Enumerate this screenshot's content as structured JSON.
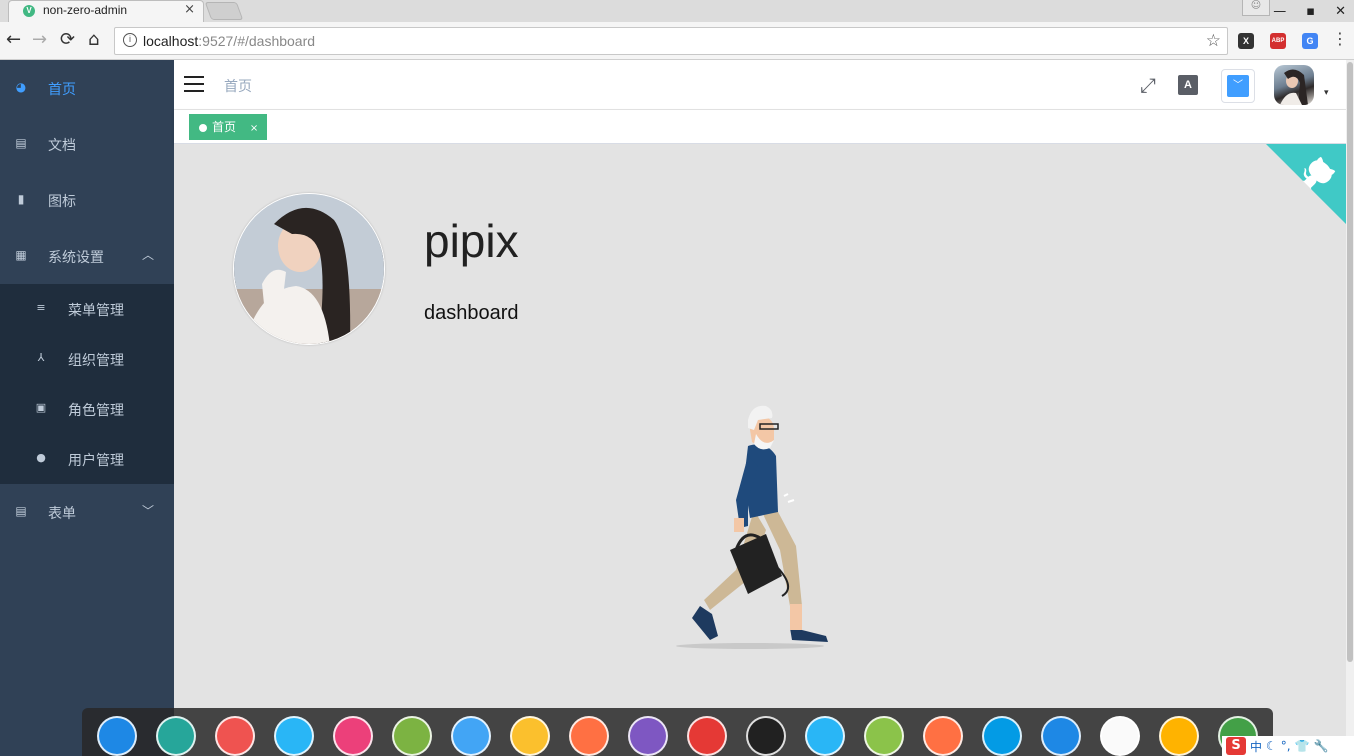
{
  "browser": {
    "tab_title": "non-zero-admin",
    "tab_close": "×",
    "favicon": "V",
    "url_host": "localhost",
    "url_rest": ":9527/#/dashboard",
    "back_icon": "←",
    "forward_icon": "→",
    "reload_icon": "⟳",
    "home_icon": "⌂",
    "info_icon": "i",
    "star_icon": "☆",
    "menu_icon": "⋮",
    "min_icon": "—",
    "max_icon": "▪",
    "close_icon": "✕",
    "extensions": [
      {
        "name": "x-extension-icon",
        "text": "X",
        "color": "#333333"
      },
      {
        "name": "adblock-plus-icon",
        "text": "ABP",
        "color": "#d32f2f"
      },
      {
        "name": "google-translate-icon",
        "text": "G",
        "color": "#4285f4"
      }
    ]
  },
  "sidebar": {
    "bg_color": "#304156",
    "active_color": "#409eff",
    "items": [
      {
        "label": "首页",
        "icon": "dashboard-icon",
        "glyph": "◕"
      },
      {
        "label": "文档",
        "icon": "document-icon",
        "glyph": "▤"
      },
      {
        "label": "图标",
        "icon": "icon-icon",
        "glyph": "▮"
      },
      {
        "label": "系统设置",
        "icon": "grid-icon",
        "glyph": "▦",
        "arrow": "︿"
      },
      {
        "label": "表单",
        "icon": "form-icon",
        "glyph": "▤",
        "arrow": "﹀"
      }
    ],
    "submenu": [
      {
        "label": "菜单管理",
        "icon": "menu-list-icon",
        "glyph": "≡"
      },
      {
        "label": "组织管理",
        "icon": "tree-icon",
        "glyph": "⅄"
      },
      {
        "label": "角色管理",
        "icon": "role-icon",
        "glyph": "▣"
      },
      {
        "label": "用户管理",
        "icon": "user-icon",
        "glyph": "●"
      }
    ]
  },
  "navbar": {
    "breadcrumb": "首页",
    "fullscreen_icon": "⤢",
    "lang_icon": "A",
    "theme_caret": "﹀",
    "avatar_caret": "▾"
  },
  "tags": {
    "active": "首页",
    "close": "×",
    "color": "#42b983"
  },
  "dashboard": {
    "username": "pipix",
    "role": "dashboard"
  },
  "dock": {
    "icons": [
      {
        "name": "deepin-launcher-icon",
        "color": "#1e88e5"
      },
      {
        "name": "deepin-store-icon",
        "color": "#26a69a"
      },
      {
        "name": "deepin-manual-icon",
        "color": "#ef5350"
      },
      {
        "name": "file-manager-icon",
        "color": "#29b6f6"
      },
      {
        "name": "app-store-icon",
        "color": "#ec407a"
      },
      {
        "name": "music-icon",
        "color": "#7cb342"
      },
      {
        "name": "video-player-icon",
        "color": "#42a5f5"
      },
      {
        "name": "chrome-icon",
        "color": "#fbc02d"
      },
      {
        "name": "settings-icon",
        "color": "#ff7043"
      },
      {
        "name": "voice-icon",
        "color": "#7e57c2"
      },
      {
        "name": "terminal-icon",
        "color": "#e53935"
      },
      {
        "name": "intellij-icon",
        "color": "#212121"
      },
      {
        "name": "draw-icon",
        "color": "#29b6f6"
      },
      {
        "name": "power-icon",
        "color": "#8bc34a"
      },
      {
        "name": "eject-icon",
        "color": "#ff7043"
      },
      {
        "name": "wifi-icon",
        "color": "#039be5"
      },
      {
        "name": "blue-app-icon",
        "color": "#1e88e5"
      },
      {
        "name": "qq-icon",
        "color": "#fafafa"
      },
      {
        "name": "calendar-icon",
        "color": "#ffb300"
      },
      {
        "name": "trash-icon",
        "color": "#43a047"
      }
    ]
  },
  "tray": {
    "ime": "S",
    "lang": "中"
  }
}
